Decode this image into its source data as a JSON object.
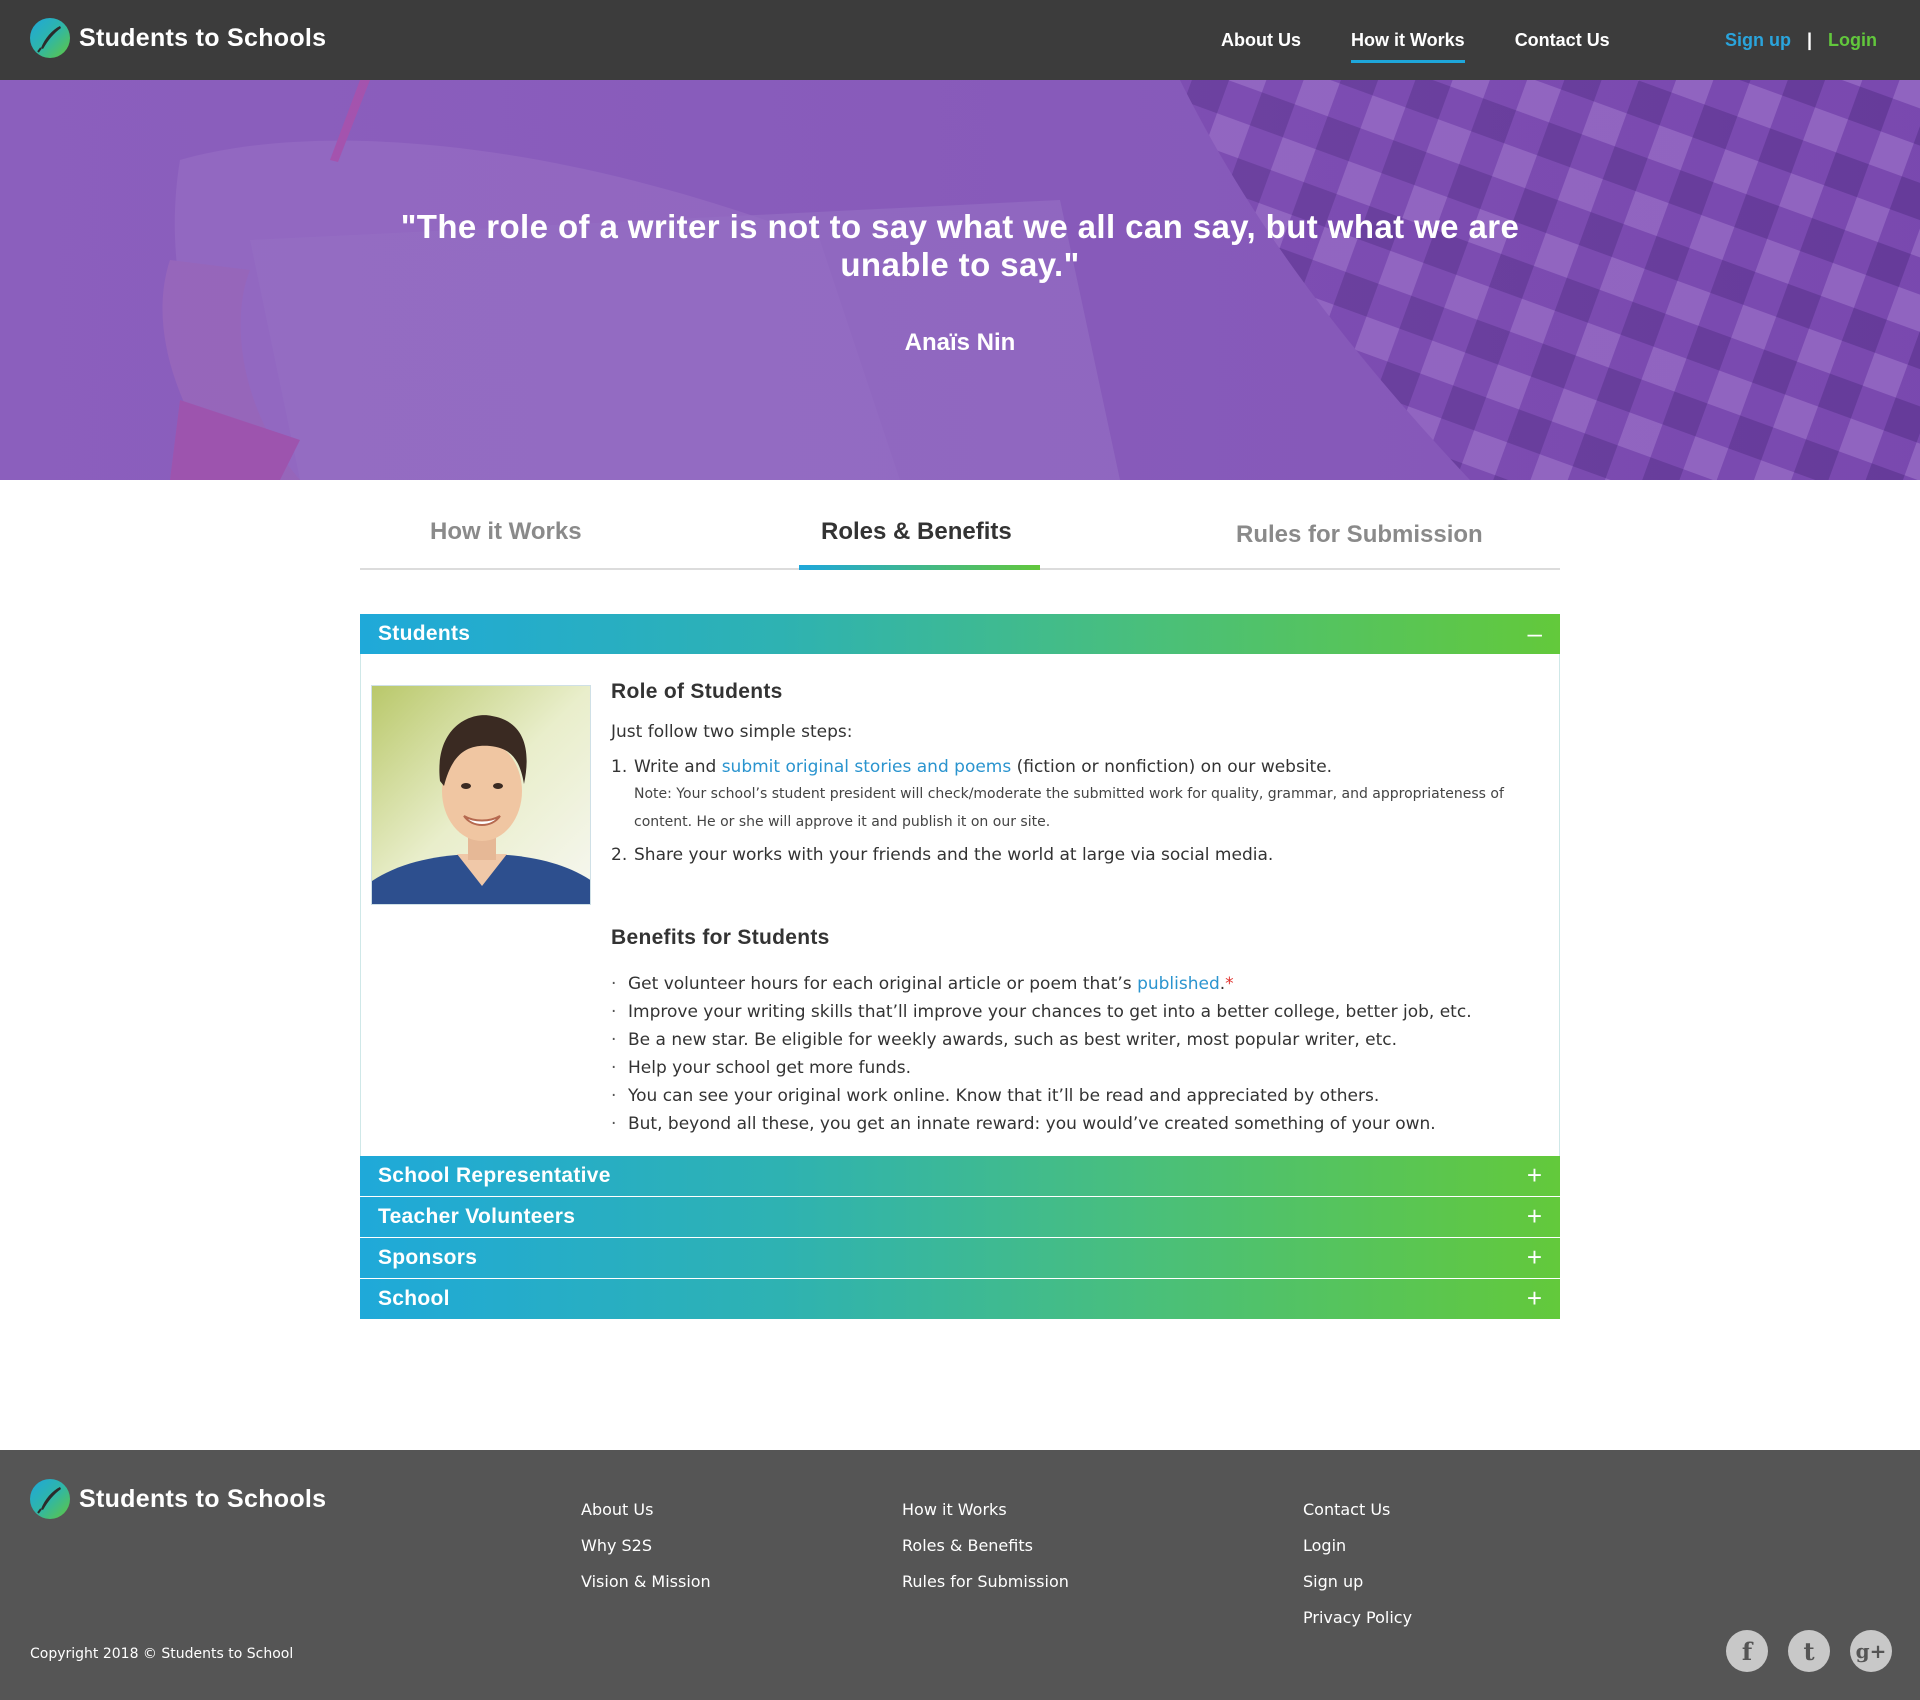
{
  "brand": {
    "name": "Students to Schools"
  },
  "nav": {
    "about": "About Us",
    "how": "How it Works",
    "contact": "Contact Us"
  },
  "auth": {
    "signup": "Sign up",
    "separator": "|",
    "login": "Login"
  },
  "hero": {
    "quote": "\"The role of a writer is not to say what we all can say, but what we are unable to say.\"",
    "author": "Anaïs Nin"
  },
  "tabs": {
    "t1": "How it Works",
    "t2": "Roles & Benefits",
    "t3": "Rules for Submission",
    "active": "Roles & Benefits"
  },
  "accordion": {
    "students": {
      "title": "Students",
      "sign": "–"
    },
    "school_rep": {
      "title": "School Representative",
      "sign": "+"
    },
    "teachers": {
      "title": "Teacher Volunteers",
      "sign": "+"
    },
    "sponsors": {
      "title": "Sponsors",
      "sign": "+"
    },
    "school": {
      "title": "School",
      "sign": "+"
    }
  },
  "students": {
    "role_heading": "Role of Students",
    "intro": "Just follow two simple steps:",
    "step1": {
      "num": "1.",
      "pre": "Write and ",
      "link": "submit original stories and poems",
      "post": " (fiction or nonfiction) on our website."
    },
    "note": "Note: Your school’s student president will check/moderate the submitted work for quality, grammar, and appropriateness of content. He or she will approve it and publish it on our site.",
    "step2": {
      "num": "2.",
      "text": "Share your works with your friends and the world at large via social media."
    },
    "benefits_heading": "Benefits for Students",
    "benefit1": {
      "pre": "Get volunteer hours for each original article or poem that’s ",
      "link": "published",
      "post": ".",
      "star": "*"
    },
    "benefit2": "Improve your writing skills that’ll improve your chances to get into a better college, better job, etc.",
    "benefit3": "Be a new star. Be eligible for weekly awards, such as best writer, most popular writer, etc.",
    "benefit4": "Help your school get more funds.",
    "benefit5": "You can see your original work online. Know that it’ll be read and appreciated by others.",
    "benefit6": "But, beyond all these, you get an innate reward: you would’ve created something of your own."
  },
  "footer": {
    "col1": [
      "About Us",
      "Why S2S",
      "Vision & Mission"
    ],
    "col2": [
      "How it Works",
      "Roles & Benefits",
      "Rules for Submission"
    ],
    "col3": [
      "Contact Us",
      "Login",
      "Sign up",
      "Privacy Policy"
    ],
    "copyright": "Copyright 2018 ©  Students to School",
    "social": {
      "facebook": "f",
      "twitter": "t",
      "google": "g+"
    }
  },
  "icons": [
    "logo-quill-icon",
    "minus-icon",
    "plus-icon",
    "facebook-icon",
    "twitter-icon",
    "google-plus-icon"
  ],
  "colors": {
    "header_bg": "#3c3c3c",
    "hero_purple": "#8558b5",
    "accent_blue": "#1ea7db",
    "accent_green": "#62c73c",
    "footer_bg": "#555555",
    "link_blue": "#2a94cf"
  }
}
